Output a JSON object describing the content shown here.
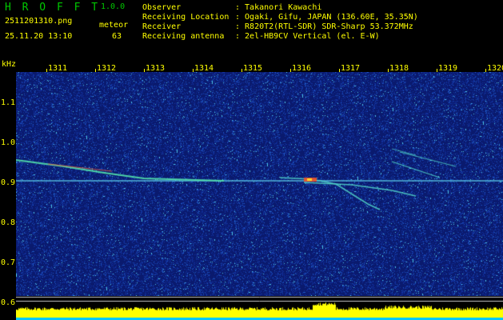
{
  "app": {
    "title": "H R O F F T",
    "version": "1.0.0"
  },
  "file": {
    "name": "2511201310.png",
    "datetime": "25.11.20 13:10"
  },
  "detection": {
    "mode": "meteor",
    "count": "63"
  },
  "info": {
    "observer_label": "Observer",
    "observer_value": ": Takanori Kawachi",
    "location_label": "Receiving Location",
    "location_value": ": Ogaki, Gifu, JAPAN (136.60E, 35.35N)",
    "receiver_label": "Receiver",
    "receiver_value": ": R820T2(RTL-SDR) SDR-Sharp 53.372MHz",
    "antenna_label": "Receiving antenna",
    "antenna_value": ": 2el-HB9CV Vertical (el. E-W)"
  },
  "axis": {
    "unit": "kHz",
    "y_ticks": [
      "1.1",
      "1.0",
      "0.9",
      "0.8",
      "0.7",
      "0.6"
    ],
    "x_ticks": [
      "1311",
      "1312",
      "1313",
      "1314",
      "1315",
      "1316",
      "1317",
      "1318",
      "1319",
      "1320"
    ]
  },
  "colors": {
    "text": "#ffff00",
    "title": "#00c800",
    "background": "#000000",
    "noise": "#1838b0",
    "baseline": "#ffff00",
    "floor": "#00c8ff"
  }
}
